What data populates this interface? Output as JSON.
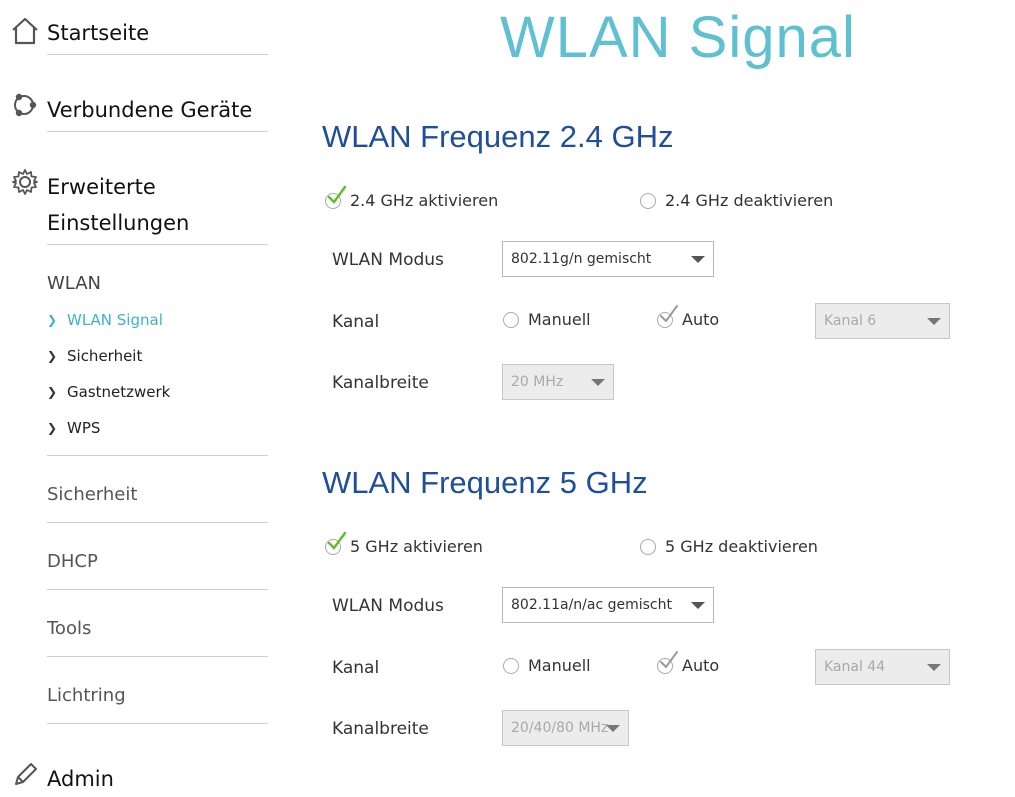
{
  "sidebar": {
    "home_label": "Startseite",
    "devices_label": "Verbundene Geräte",
    "advanced_label_line1": "Erweiterte",
    "advanced_label_line2": "Einstellungen",
    "wlan_heading": "WLAN",
    "wlan_items": [
      "WLAN Signal",
      "Sicherheit",
      "Gastnetzwerk",
      "WPS"
    ],
    "sections": [
      "Sicherheit",
      "DHCP",
      "Tools",
      "Lichtring"
    ],
    "admin_label": "Admin"
  },
  "main": {
    "title": "WLAN Signal",
    "band24": {
      "title": "WLAN Frequenz 2.4 GHz",
      "enable_label": "2.4 GHz aktivieren",
      "disable_label": "2.4 GHz deaktivieren",
      "mode_label": "WLAN Modus",
      "mode_value": "802.11g/n gemischt",
      "channel_label": "Kanal",
      "manual_label": "Manuell",
      "auto_label": "Auto",
      "channel_value": "Kanal 6",
      "width_label": "Kanalbreite",
      "width_value": "20 MHz"
    },
    "band5": {
      "title": "WLAN Frequenz 5 GHz",
      "enable_label": "5 GHz aktivieren",
      "disable_label": "5 GHz deaktivieren",
      "mode_label": "WLAN Modus",
      "mode_value": "802.11a/n/ac gemischt",
      "channel_label": "Kanal",
      "manual_label": "Manuell",
      "auto_label": "Auto",
      "channel_value": "Kanal 44",
      "width_label": "Kanalbreite",
      "width_value": "20/40/80 MHz"
    }
  },
  "colors": {
    "accent": "#5fc0d2",
    "section_title": "#1f4e9a",
    "active_link": "#3fb2c8",
    "check_green": "#5cbf2a",
    "check_grey": "#9a9a9a"
  },
  "icons": [
    "home-icon",
    "devices-icon",
    "gear-icon",
    "chevron-right-icon",
    "pencil-icon",
    "check-icon"
  ]
}
